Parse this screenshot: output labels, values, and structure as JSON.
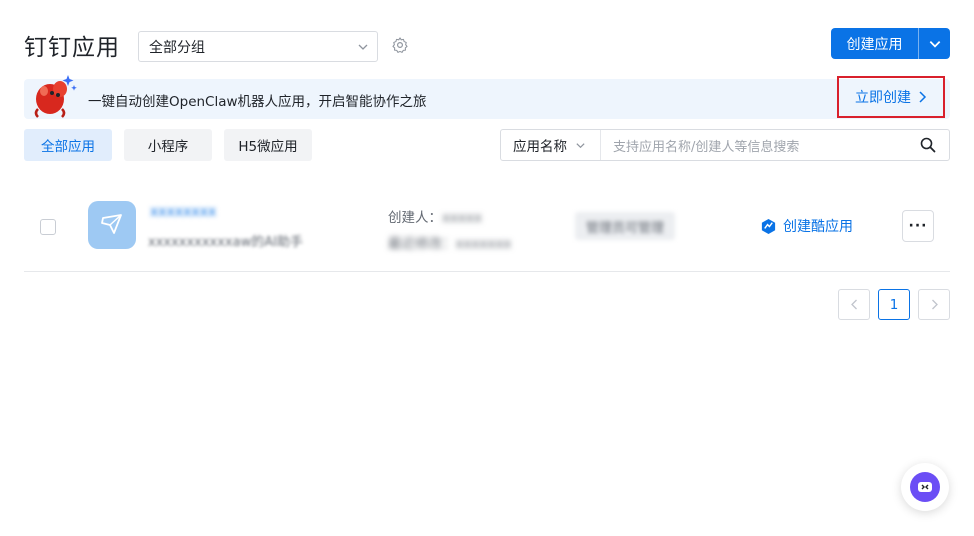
{
  "header": {
    "title": "钉钉应用",
    "group_select": "全部分组",
    "create_button": "创建应用"
  },
  "banner": {
    "message": "一键自动创建OpenClaw机器人应用，开启智能协作之旅",
    "cta": "立即创建"
  },
  "tabs": [
    {
      "label": "全部应用",
      "active": true
    },
    {
      "label": "小程序",
      "active": false
    },
    {
      "label": "H5微应用",
      "active": false
    }
  ],
  "search": {
    "field": "应用名称",
    "placeholder": "支持应用名称/创建人等信息搜索"
  },
  "apps": [
    {
      "name": "xxxxxxxx",
      "description": "xxxxxxxxxxxaw的AI助手",
      "creator_label": "创建人：",
      "creator": "xxxxx",
      "updated": "最近修改：xxxxxxx",
      "role": "管理员可管理",
      "action": "创建酷应用",
      "more": "···"
    }
  ],
  "pagination": {
    "current": "1"
  },
  "colors": {
    "primary": "#0a73e6",
    "highlight_border": "#d9202c",
    "banner_bg": "#eef5fd"
  },
  "icons": [
    "settings-icon",
    "chevron-down-icon",
    "lobster-mascot-icon",
    "chevron-right-icon",
    "search-icon",
    "cool-app-icon",
    "app-logo-icon",
    "assistant-icon"
  ]
}
